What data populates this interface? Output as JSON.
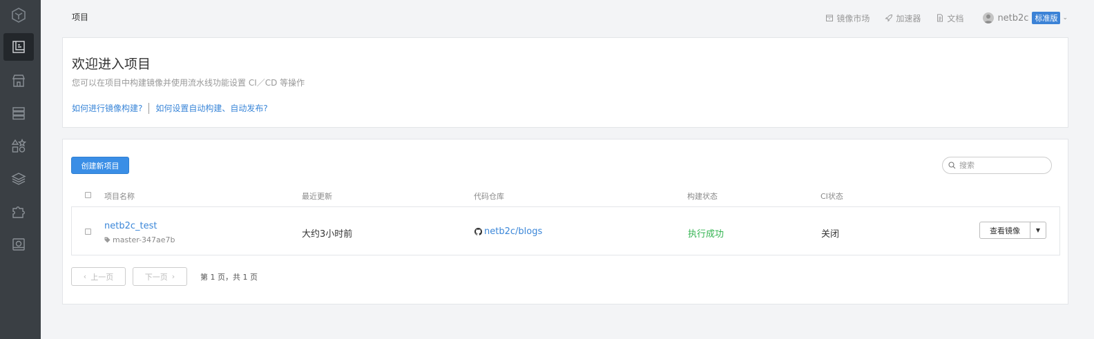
{
  "sidebar": {
    "items": [
      {
        "icon": "project-icon",
        "active": true
      },
      {
        "icon": "store-icon",
        "active": false
      },
      {
        "icon": "server-icon",
        "active": false
      },
      {
        "icon": "shapes-icon",
        "active": false
      },
      {
        "icon": "layers-icon",
        "active": false
      },
      {
        "icon": "puzzle-icon",
        "active": false
      },
      {
        "icon": "disk-icon",
        "active": false
      }
    ]
  },
  "header": {
    "breadcrumb": "项目",
    "nav": {
      "market": "镜像市场",
      "accelerator": "加速器",
      "docs": "文档"
    },
    "user": {
      "name": "netb2c",
      "plan": "标准版"
    }
  },
  "welcome": {
    "title": "欢迎进入项目",
    "subtitle": "您可以在项目中构建镜像并使用流水线功能设置 CI／CD 等操作",
    "link1": "如何进行镜像构建?",
    "link2": "如何设置自动构建、自动发布?"
  },
  "toolbar": {
    "create_label": "创建新项目",
    "search_placeholder": "搜索"
  },
  "table": {
    "headers": {
      "name": "项目名称",
      "updated": "最近更新",
      "repo": "代码仓库",
      "build": "构建状态",
      "ci": "CI状态"
    },
    "rows": [
      {
        "name": "netb2c_test",
        "tag": "master-347ae7b",
        "updated": "大约3小时前",
        "repo": "netb2c/blogs",
        "build_status": "执行成功",
        "ci_status": "关闭",
        "action_label": "查看镜像"
      }
    ]
  },
  "pagination": {
    "prev": "上一页",
    "next": "下一页",
    "info": "第 1 页，共 1 页"
  },
  "colors": {
    "sidebar": "#3a3f44",
    "accent": "#3a8ee6",
    "link": "#3a86d8",
    "success": "#32b350"
  }
}
